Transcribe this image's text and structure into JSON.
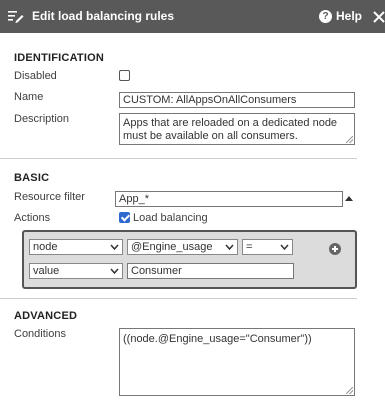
{
  "header": {
    "title": "Edit load balancing rules",
    "help_label": "Help",
    "menu_icon": "list-edit-icon",
    "help_icon_glyph": "?"
  },
  "identification": {
    "section_title": "IDENTIFICATION",
    "disabled_label": "Disabled",
    "disabled_checked": false,
    "name_label": "Name",
    "name_value": "CUSTOM: AllAppsOnAllConsumers",
    "description_label": "Description",
    "description_value": "Apps that are reloaded on a dedicated node must be available on all consumers."
  },
  "basic": {
    "section_title": "BASIC",
    "resource_filter_label": "Resource filter",
    "resource_filter_value": "App_*",
    "actions_label": "Actions",
    "load_balancing_label": "Load balancing",
    "load_balancing_checked": true,
    "rule": {
      "row1": {
        "object": "node",
        "property": "@Engine_usage",
        "operator": "="
      },
      "row2": {
        "type": "value",
        "value": "Consumer"
      }
    }
  },
  "advanced": {
    "section_title": "ADVANCED",
    "conditions_label": "Conditions",
    "conditions_value": "((node.@Engine_usage=\"Consumer\"))"
  },
  "colors": {
    "header_bg": "#595959",
    "checkbox_checked": "#2f6ad0",
    "rule_box_bg": "#dcdcdc"
  }
}
